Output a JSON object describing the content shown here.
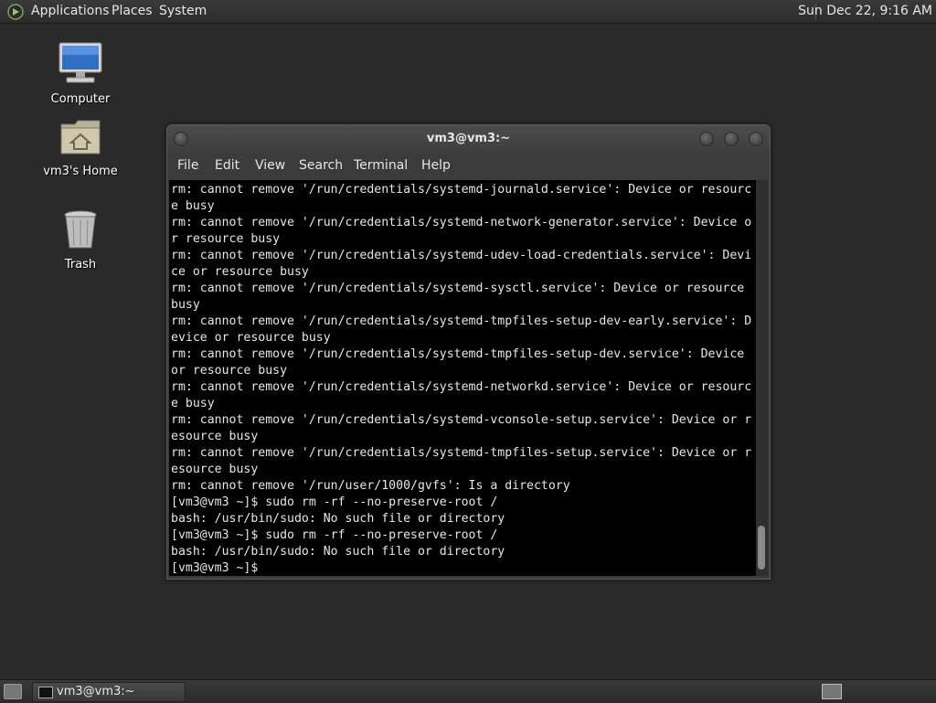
{
  "top_panel": {
    "menus": [
      "Applications",
      "Places",
      "System"
    ],
    "clock": "Sun Dec 22,  9:16 AM"
  },
  "desktop": {
    "icons": [
      {
        "label": "Computer",
        "icon": "computer-icon"
      },
      {
        "label": "vm3's Home",
        "icon": "home-folder-icon"
      },
      {
        "label": "Trash",
        "icon": "trash-icon"
      }
    ]
  },
  "window": {
    "title": "vm3@vm3:~",
    "menus": [
      "File",
      "Edit",
      "View",
      "Search",
      "Terminal",
      "Help"
    ],
    "terminal_lines": [
      "rm: cannot remove '/run/credentials/systemd-journald.service': Device or resourc",
      "e busy",
      "rm: cannot remove '/run/credentials/systemd-network-generator.service': Device o",
      "r resource busy",
      "rm: cannot remove '/run/credentials/systemd-udev-load-credentials.service': Devi",
      "ce or resource busy",
      "rm: cannot remove '/run/credentials/systemd-sysctl.service': Device or resource",
      "busy",
      "rm: cannot remove '/run/credentials/systemd-tmpfiles-setup-dev-early.service': D",
      "evice or resource busy",
      "rm: cannot remove '/run/credentials/systemd-tmpfiles-setup-dev.service': Device",
      "or resource busy",
      "rm: cannot remove '/run/credentials/systemd-networkd.service': Device or resourc",
      "e busy",
      "rm: cannot remove '/run/credentials/systemd-vconsole-setup.service': Device or r",
      "esource busy",
      "rm: cannot remove '/run/credentials/systemd-tmpfiles-setup.service': Device or r",
      "esource busy",
      "rm: cannot remove '/run/user/1000/gvfs': Is a directory",
      "[vm3@vm3 ~]$ sudo rm -rf --no-preserve-root /",
      "bash: /usr/bin/sudo: No such file or directory",
      "[vm3@vm3 ~]$ sudo rm -rf --no-preserve-root /",
      "bash: /usr/bin/sudo: No such file or directory",
      "[vm3@vm3 ~]$"
    ]
  },
  "bottom_panel": {
    "task_label": "vm3@vm3:~"
  },
  "colors": {
    "desktop_bg": "#2a2a2a",
    "terminal_bg": "#000000",
    "terminal_fg": "#e6e6e6"
  }
}
